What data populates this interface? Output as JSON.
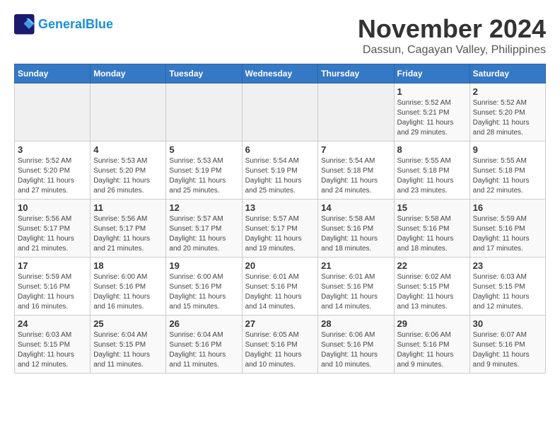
{
  "logo": {
    "line1": "General",
    "line2": "Blue"
  },
  "title": "November 2024",
  "subtitle": "Dassun, Cagayan Valley, Philippines",
  "headers": [
    "Sunday",
    "Monday",
    "Tuesday",
    "Wednesday",
    "Thursday",
    "Friday",
    "Saturday"
  ],
  "weeks": [
    [
      {
        "day": "",
        "info": ""
      },
      {
        "day": "",
        "info": ""
      },
      {
        "day": "",
        "info": ""
      },
      {
        "day": "",
        "info": ""
      },
      {
        "day": "",
        "info": ""
      },
      {
        "day": "1",
        "info": "Sunrise: 5:52 AM\nSunset: 5:21 PM\nDaylight: 11 hours and 29 minutes."
      },
      {
        "day": "2",
        "info": "Sunrise: 5:52 AM\nSunset: 5:20 PM\nDaylight: 11 hours and 28 minutes."
      }
    ],
    [
      {
        "day": "3",
        "info": "Sunrise: 5:52 AM\nSunset: 5:20 PM\nDaylight: 11 hours and 27 minutes."
      },
      {
        "day": "4",
        "info": "Sunrise: 5:53 AM\nSunset: 5:20 PM\nDaylight: 11 hours and 26 minutes."
      },
      {
        "day": "5",
        "info": "Sunrise: 5:53 AM\nSunset: 5:19 PM\nDaylight: 11 hours and 25 minutes."
      },
      {
        "day": "6",
        "info": "Sunrise: 5:54 AM\nSunset: 5:19 PM\nDaylight: 11 hours and 25 minutes."
      },
      {
        "day": "7",
        "info": "Sunrise: 5:54 AM\nSunset: 5:18 PM\nDaylight: 11 hours and 24 minutes."
      },
      {
        "day": "8",
        "info": "Sunrise: 5:55 AM\nSunset: 5:18 PM\nDaylight: 11 hours and 23 minutes."
      },
      {
        "day": "9",
        "info": "Sunrise: 5:55 AM\nSunset: 5:18 PM\nDaylight: 11 hours and 22 minutes."
      }
    ],
    [
      {
        "day": "10",
        "info": "Sunrise: 5:56 AM\nSunset: 5:17 PM\nDaylight: 11 hours and 21 minutes."
      },
      {
        "day": "11",
        "info": "Sunrise: 5:56 AM\nSunset: 5:17 PM\nDaylight: 11 hours and 21 minutes."
      },
      {
        "day": "12",
        "info": "Sunrise: 5:57 AM\nSunset: 5:17 PM\nDaylight: 11 hours and 20 minutes."
      },
      {
        "day": "13",
        "info": "Sunrise: 5:57 AM\nSunset: 5:17 PM\nDaylight: 11 hours and 19 minutes."
      },
      {
        "day": "14",
        "info": "Sunrise: 5:58 AM\nSunset: 5:16 PM\nDaylight: 11 hours and 18 minutes."
      },
      {
        "day": "15",
        "info": "Sunrise: 5:58 AM\nSunset: 5:16 PM\nDaylight: 11 hours and 18 minutes."
      },
      {
        "day": "16",
        "info": "Sunrise: 5:59 AM\nSunset: 5:16 PM\nDaylight: 11 hours and 17 minutes."
      }
    ],
    [
      {
        "day": "17",
        "info": "Sunrise: 5:59 AM\nSunset: 5:16 PM\nDaylight: 11 hours and 16 minutes."
      },
      {
        "day": "18",
        "info": "Sunrise: 6:00 AM\nSunset: 5:16 PM\nDaylight: 11 hours and 16 minutes."
      },
      {
        "day": "19",
        "info": "Sunrise: 6:00 AM\nSunset: 5:16 PM\nDaylight: 11 hours and 15 minutes."
      },
      {
        "day": "20",
        "info": "Sunrise: 6:01 AM\nSunset: 5:16 PM\nDaylight: 11 hours and 14 minutes."
      },
      {
        "day": "21",
        "info": "Sunrise: 6:01 AM\nSunset: 5:16 PM\nDaylight: 11 hours and 14 minutes."
      },
      {
        "day": "22",
        "info": "Sunrise: 6:02 AM\nSunset: 5:15 PM\nDaylight: 11 hours and 13 minutes."
      },
      {
        "day": "23",
        "info": "Sunrise: 6:03 AM\nSunset: 5:15 PM\nDaylight: 11 hours and 12 minutes."
      }
    ],
    [
      {
        "day": "24",
        "info": "Sunrise: 6:03 AM\nSunset: 5:15 PM\nDaylight: 11 hours and 12 minutes."
      },
      {
        "day": "25",
        "info": "Sunrise: 6:04 AM\nSunset: 5:15 PM\nDaylight: 11 hours and 11 minutes."
      },
      {
        "day": "26",
        "info": "Sunrise: 6:04 AM\nSunset: 5:16 PM\nDaylight: 11 hours and 11 minutes."
      },
      {
        "day": "27",
        "info": "Sunrise: 6:05 AM\nSunset: 5:16 PM\nDaylight: 11 hours and 10 minutes."
      },
      {
        "day": "28",
        "info": "Sunrise: 6:06 AM\nSunset: 5:16 PM\nDaylight: 11 hours and 10 minutes."
      },
      {
        "day": "29",
        "info": "Sunrise: 6:06 AM\nSunset: 5:16 PM\nDaylight: 11 hours and 9 minutes."
      },
      {
        "day": "30",
        "info": "Sunrise: 6:07 AM\nSunset: 5:16 PM\nDaylight: 11 hours and 9 minutes."
      }
    ]
  ]
}
